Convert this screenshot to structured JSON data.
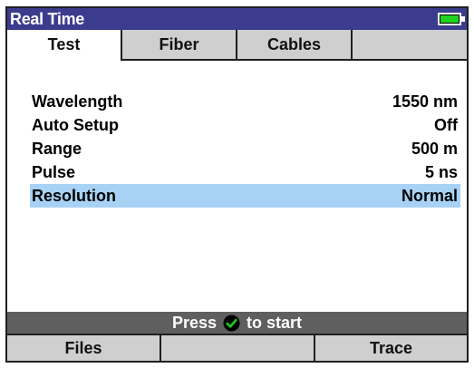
{
  "window": {
    "title": "Real Time",
    "battery_icon": "battery-icon",
    "battery_level": 0.9
  },
  "tabs": [
    {
      "label": "Test",
      "active": true
    },
    {
      "label": "Fiber",
      "active": false
    },
    {
      "label": "Cables",
      "active": false
    }
  ],
  "params": [
    {
      "label": "Wavelength",
      "value": "1550 nm"
    },
    {
      "label": "Auto Setup",
      "value": "Off"
    },
    {
      "label": "Range",
      "value": "500 m"
    },
    {
      "label": "Pulse",
      "value": "5 ns"
    },
    {
      "label": "Resolution",
      "value": "Normal",
      "selected": true
    }
  ],
  "status": {
    "prefix": "Press",
    "suffix": "to start",
    "icon": "check-icon"
  },
  "softkeys": {
    "left": "Files",
    "middle": "",
    "right": "Trace"
  },
  "colors": {
    "titlebar": "#3c3c8e",
    "selection": "#a8d2f5",
    "battery": "#1fd31f",
    "status_bar": "#5f5f5f",
    "check": "#1fbf1f"
  }
}
